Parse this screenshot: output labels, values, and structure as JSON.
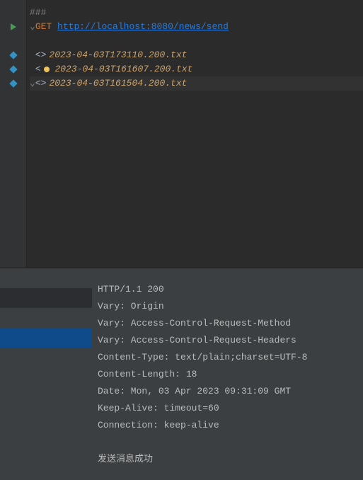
{
  "editor": {
    "separator": "###",
    "request": {
      "method": "GET",
      "url": "http://localhost:8080/news/send"
    },
    "responses": [
      {
        "brackets": "<>",
        "file": "2023-04-03T173110.200.txt",
        "highlighted": false,
        "bulb": false
      },
      {
        "brackets": "<",
        "file": "2023-04-03T161607.200.txt",
        "highlighted": false,
        "bulb": true
      },
      {
        "brackets": "<>",
        "file": "2023-04-03T161504.200.txt",
        "highlighted": true,
        "bulb": false
      }
    ]
  },
  "response_panel": {
    "headers": [
      "HTTP/1.1 200",
      "Vary: Origin",
      "Vary: Access-Control-Request-Method",
      "Vary: Access-Control-Request-Headers",
      "Content-Type: text/plain;charset=UTF-8",
      "Content-Length: 18",
      "Date: Mon, 03 Apr 2023 09:31:09 GMT",
      "Keep-Alive: timeout=60",
      "Connection: keep-alive"
    ],
    "body": "发送消息成功"
  }
}
